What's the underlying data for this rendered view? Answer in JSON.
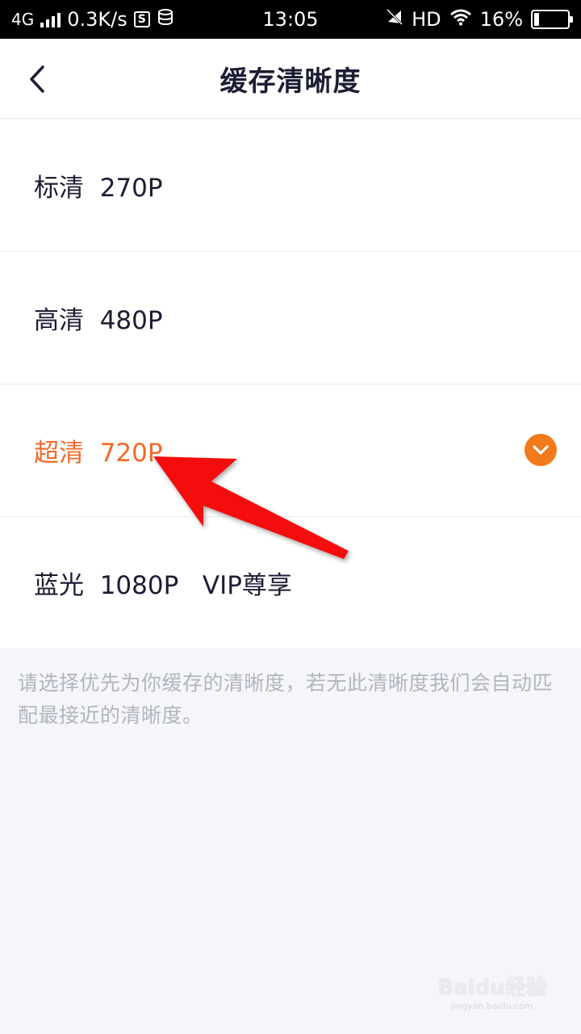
{
  "status_bar": {
    "network": "4G",
    "speed": "0.3K/s",
    "time": "13:05",
    "hd": "HD",
    "battery_percent": "16%",
    "battery_level": 0.16
  },
  "header": {
    "title": "缓存清晰度",
    "back_icon": "chevron-left-icon"
  },
  "options": [
    {
      "label": "标清  270P",
      "selected": false
    },
    {
      "label": "高清  480P",
      "selected": false
    },
    {
      "label": "超清  720P",
      "selected": true
    },
    {
      "label": "蓝光  1080P   VIP尊享",
      "selected": false
    }
  ],
  "hint": "请选择优先为你缓存的清晰度，若无此清晰度我们会自动匹配最接近的清晰度。",
  "watermark": {
    "brand": "Baidu经验",
    "url": "jingyan.baidu.com"
  },
  "colors": {
    "accent": "#f06a2a",
    "check_bg": "#f27a1a",
    "annotation_arrow": "#f50f0f",
    "text": "#1c1d33",
    "hint": "#b2b4bf"
  }
}
